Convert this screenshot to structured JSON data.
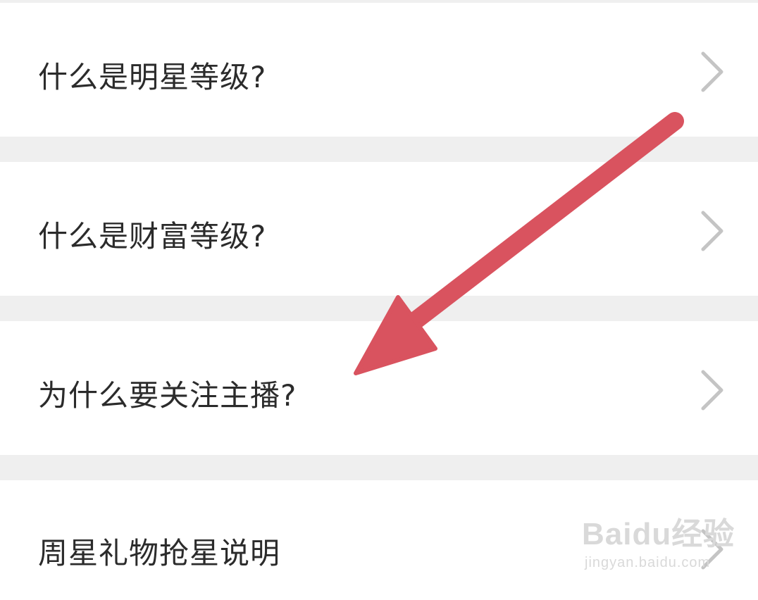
{
  "list": {
    "items": [
      {
        "label": "什么是明星等级?"
      },
      {
        "label": "什么是财富等级?"
      },
      {
        "label": "为什么要关注主播?"
      },
      {
        "label": "周星礼物抢星说明"
      }
    ]
  },
  "icons": {
    "row_chevron": "chevron-right-icon",
    "annotation": "red-arrow-icon"
  },
  "colors": {
    "background": "#efefef",
    "row": "#ffffff",
    "text": "#2b2b2b",
    "chevron": "#c4c4c4",
    "arrow": "#d9535f",
    "watermark": "#d9d9d9"
  },
  "watermark": {
    "brand": "Baidu经验",
    "url": "jingyan.baidu.com"
  }
}
